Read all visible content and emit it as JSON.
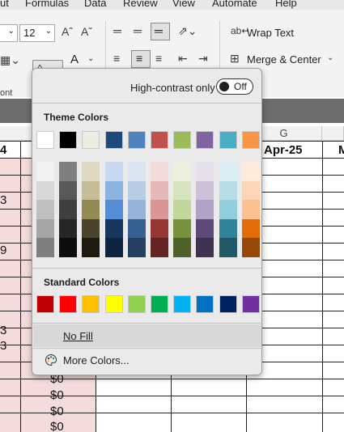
{
  "menubar": {
    "items": [
      "ut",
      "Formulas",
      "Data",
      "Review",
      "View",
      "Automate",
      "Help"
    ]
  },
  "ribbon": {
    "font_size": "12",
    "wrap_text_label": "Wrap Text",
    "merge_center_label": "Merge & Center",
    "group_label": "ont"
  },
  "sheet": {
    "column_header_g": "G",
    "header_cells": [
      "4",
      "Apr-25",
      "M"
    ],
    "left_values": [
      "3",
      "9",
      "3",
      "3"
    ],
    "dollar_values": [
      "$0",
      "$0",
      "$0",
      "$0"
    ]
  },
  "dropdown": {
    "high_contrast_label": "High-contrast only",
    "toggle_label": "Off",
    "theme_colors_label": "Theme Colors",
    "standard_colors_label": "Standard Colors",
    "no_fill_label": "No Fill",
    "more_colors_label": "More Colors...",
    "theme_top": [
      "#ffffff",
      "#000000",
      "#eeece1",
      "#1f497d",
      "#4f81bd",
      "#c0504d",
      "#9bbb59",
      "#8064a2",
      "#4bacc6",
      "#f79646"
    ],
    "theme_shades": [
      [
        "#f2f2f2",
        "#d8d8d8",
        "#bfbfbf",
        "#a5a5a5",
        "#7f7f7f"
      ],
      [
        "#7f7f7f",
        "#595959",
        "#3f3f3f",
        "#262626",
        "#0c0c0c"
      ],
      [
        "#ddd9c3",
        "#c4bd97",
        "#938953",
        "#494429",
        "#1d1b10"
      ],
      [
        "#c6d9f0",
        "#8db3e2",
        "#548dd4",
        "#17365d",
        "#0f243e"
      ],
      [
        "#dbe5f1",
        "#b8cce4",
        "#95b3d7",
        "#366092",
        "#244061"
      ],
      [
        "#f2dcdb",
        "#e5b9b7",
        "#d99694",
        "#953734",
        "#632423"
      ],
      [
        "#ebf1dd",
        "#d7e3bc",
        "#c3d69b",
        "#76923c",
        "#4f6128"
      ],
      [
        "#e5e0ec",
        "#ccc1d9",
        "#b2a2c7",
        "#5f497a",
        "#3f3151"
      ],
      [
        "#dbeef3",
        "#b7dde8",
        "#92cddc",
        "#31859b",
        "#205867"
      ],
      [
        "#fdeada",
        "#fbd5b5",
        "#fac08f",
        "#e36c09",
        "#974806"
      ]
    ],
    "standard": [
      "#c00000",
      "#ff0000",
      "#ffc000",
      "#ffff00",
      "#92d050",
      "#00b050",
      "#00b0f0",
      "#0070c0",
      "#002060",
      "#7030a0"
    ]
  }
}
